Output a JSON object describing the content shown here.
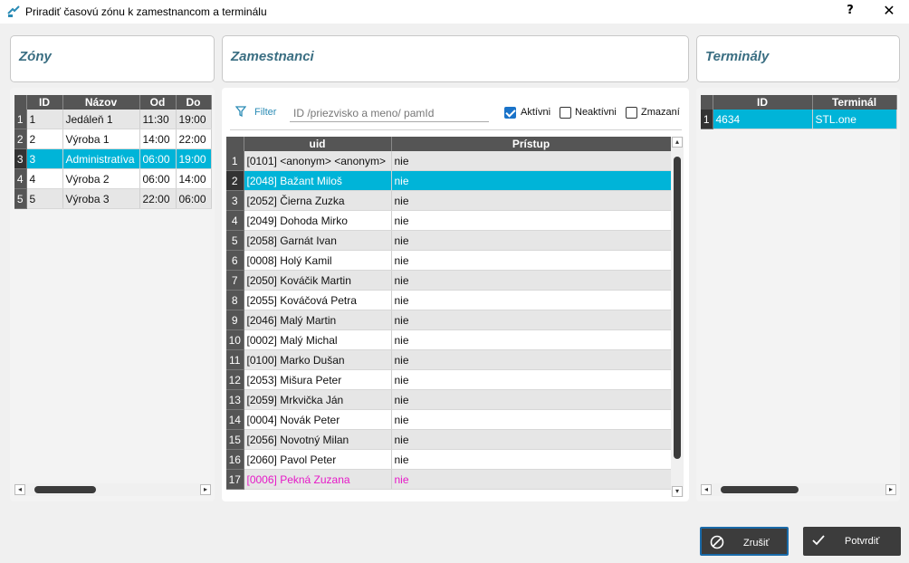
{
  "window": {
    "title": "Priradiť časovú zónu k zamestnancom a terminálu",
    "help": "?",
    "close": "✕"
  },
  "panels": {
    "zones_title": "Zóny",
    "employees_title": "Zamestnanci",
    "terminals_title": "Terminály"
  },
  "zones": {
    "columns": [
      "ID",
      "Názov",
      "Od",
      "Do"
    ],
    "rows": [
      {
        "n": "1",
        "id": "1",
        "name": "Jedáleň 1",
        "from": "11:30",
        "to": "19:00"
      },
      {
        "n": "2",
        "id": "2",
        "name": "Výroba 1",
        "from": "14:00",
        "to": "22:00"
      },
      {
        "n": "3",
        "id": "3",
        "name": "Administratíva",
        "from": "06:00",
        "to": "19:00"
      },
      {
        "n": "4",
        "id": "4",
        "name": "Výroba 2",
        "from": "06:00",
        "to": "14:00"
      },
      {
        "n": "5",
        "id": "5",
        "name": "Výroba 3",
        "from": "22:00",
        "to": "06:00"
      }
    ],
    "selected_row": 3
  },
  "filter": {
    "label": "Filter",
    "placeholder": "ID /priezvisko a meno/ pamId",
    "value": "",
    "checkboxes": [
      {
        "label": "Aktívni",
        "checked": true
      },
      {
        "label": "Neaktívni",
        "checked": false
      },
      {
        "label": "Zmazaní",
        "checked": false
      }
    ]
  },
  "employees": {
    "columns": [
      "uid",
      "Prístup"
    ],
    "rows": [
      {
        "n": "1",
        "uid": "[0101] <anonym> <anonym>",
        "access": "nie"
      },
      {
        "n": "2",
        "uid": "[2048] Bažant Miloš",
        "access": "nie"
      },
      {
        "n": "3",
        "uid": "[2052] Čierna Zuzka",
        "access": "nie"
      },
      {
        "n": "4",
        "uid": "[2049] Dohoda Mirko",
        "access": "nie"
      },
      {
        "n": "5",
        "uid": "[2058] Garnát Ivan",
        "access": "nie"
      },
      {
        "n": "6",
        "uid": "[0008] Holý Kamil",
        "access": "nie"
      },
      {
        "n": "7",
        "uid": "[2050] Kováčik Martin",
        "access": "nie"
      },
      {
        "n": "8",
        "uid": "[2055] Kováčová Petra",
        "access": "nie"
      },
      {
        "n": "9",
        "uid": "[2046] Malý Martin",
        "access": "nie"
      },
      {
        "n": "10",
        "uid": "[0002] Malý Michal",
        "access": "nie"
      },
      {
        "n": "11",
        "uid": "[0100] Marko Dušan",
        "access": "nie"
      },
      {
        "n": "12",
        "uid": "[2053] Mišura Peter",
        "access": "nie"
      },
      {
        "n": "13",
        "uid": "[2059] Mrkvička Ján",
        "access": "nie"
      },
      {
        "n": "14",
        "uid": "[0004] Novák Peter",
        "access": "nie"
      },
      {
        "n": "15",
        "uid": "[2056] Novotný Milan",
        "access": "nie"
      },
      {
        "n": "16",
        "uid": "[2060] Pavol Peter",
        "access": "nie"
      },
      {
        "n": "17",
        "uid": "[0006] Pekná Zuzana",
        "access": "nie"
      }
    ],
    "selected_row": 2,
    "highlight_row": 17,
    "highlight_color": "#e619c8"
  },
  "terminals": {
    "columns": [
      "ID",
      "Terminál"
    ],
    "rows": [
      {
        "n": "1",
        "id": "4634",
        "name": "STL.one"
      }
    ],
    "selected_row": 1
  },
  "buttons": {
    "cancel": "Zrušiť",
    "confirm": "Potvrdiť"
  },
  "colors": {
    "selection": "#00b4d8",
    "header": "#555555",
    "title_accent": "#3a6e82",
    "button": "#3c3c3c"
  }
}
